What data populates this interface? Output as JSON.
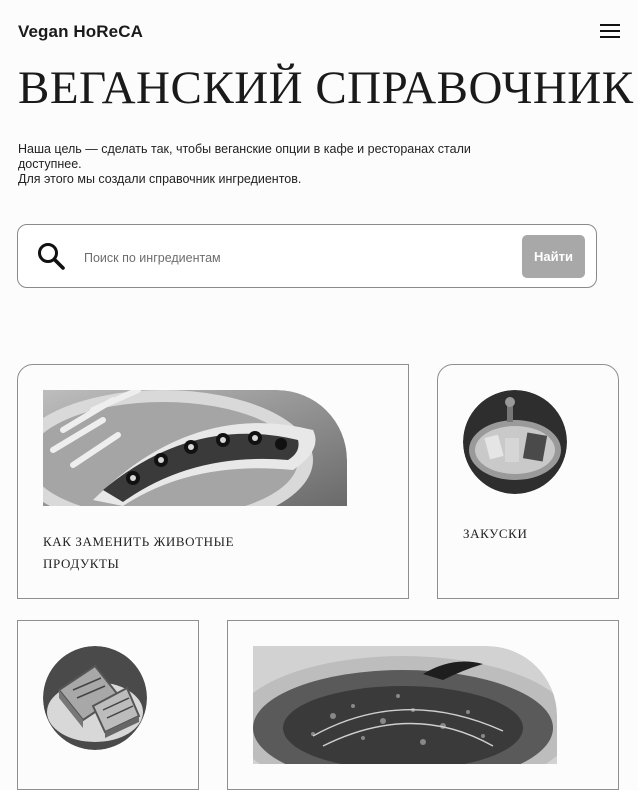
{
  "header": {
    "brand": "Vegan HoReCA",
    "menu_icon": "hamburger-menu-icon"
  },
  "hero": {
    "title": "ВЕГАНСКИЙ СПРАВОЧНИК",
    "intro_line1": "Наша цель — сделать так, чтобы веганские опции в кафе и ресторанах стали доступнее.",
    "intro_line2": "Для этого мы создали справочник ингредиентов."
  },
  "search": {
    "icon": "search-icon",
    "placeholder": "Поиск по ингредиентам",
    "value": "",
    "button_label": "Найти",
    "button_color": "#a8a8a8"
  },
  "cards": [
    {
      "label": "Как заменить животные продукты",
      "image": "hot-dog-photo"
    },
    {
      "label": "Закуски",
      "image": "snacks-platter-photo"
    },
    {
      "label": "",
      "image": "sandwich-photo"
    },
    {
      "label": "",
      "image": "salad-dish-photo"
    }
  ]
}
